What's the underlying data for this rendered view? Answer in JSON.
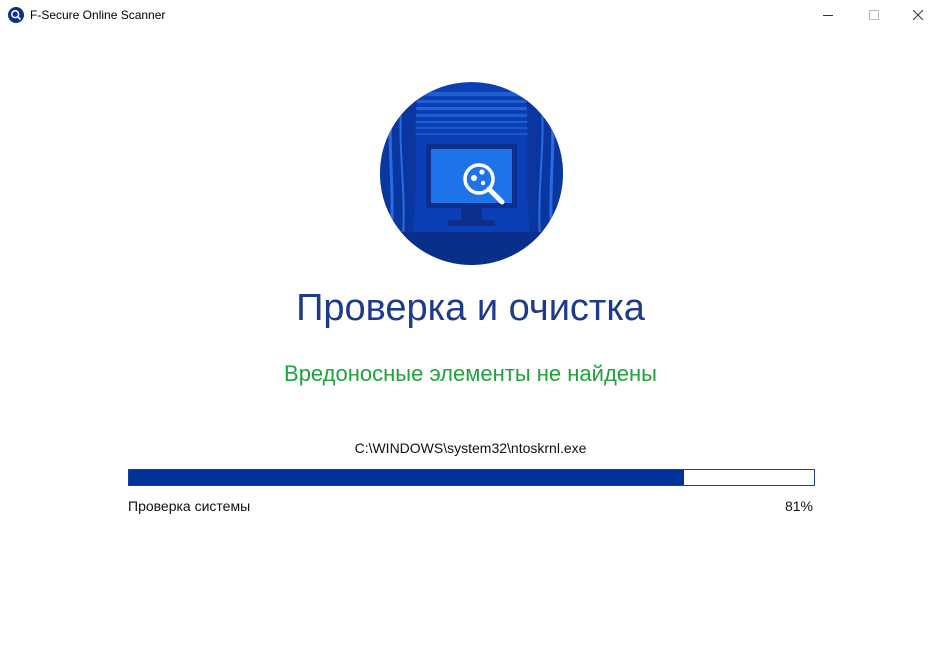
{
  "window": {
    "title": "F-Secure Online Scanner",
    "app_icon": "magnifier-icon",
    "controls": [
      "minimize-icon",
      "maximize-icon",
      "close-icon"
    ]
  },
  "hero": {
    "icon": "monitor-scan-icon"
  },
  "main": {
    "heading": "Проверка и очистка",
    "status": "Вредоносные элементы не найдены",
    "current_file": "C:\\WINDOWS\\system32\\ntoskrnl.exe"
  },
  "progress": {
    "label": "Проверка системы",
    "percent_text": "81%",
    "value": 0.81
  },
  "colors": {
    "heading": "#1e3a8a",
    "status": "#1fa33a",
    "progress_fill": "#003399",
    "hero_circle": "#0a3fb5"
  }
}
